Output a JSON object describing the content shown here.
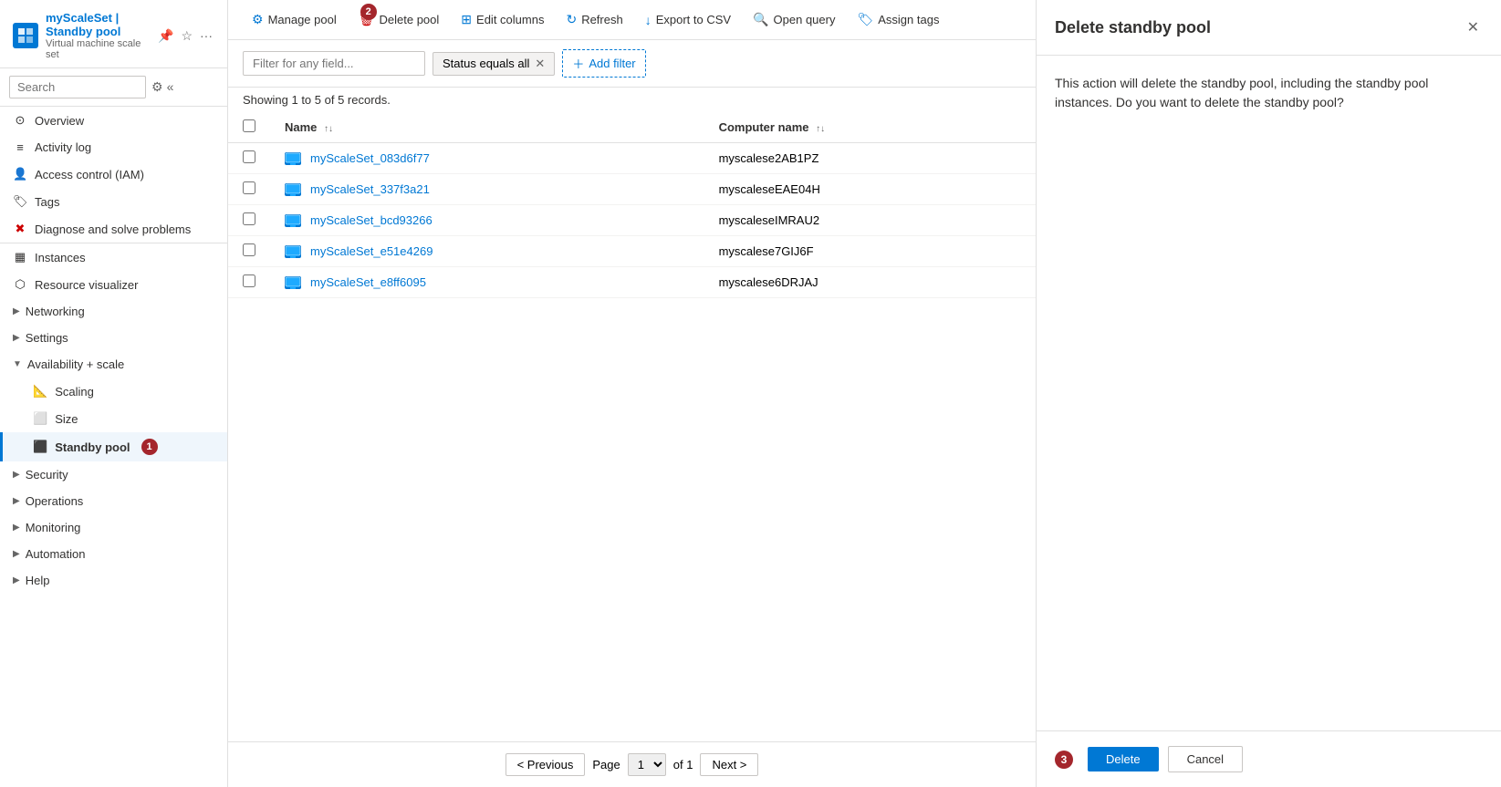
{
  "sidebar": {
    "brand": {
      "name": "myScaleSet",
      "separator": " | ",
      "section": "Standby pool",
      "subtitle": "Virtual machine scale set"
    },
    "search_placeholder": "Search",
    "nav_items": [
      {
        "id": "overview",
        "label": "Overview",
        "icon": "⊙",
        "active": false
      },
      {
        "id": "activity-log",
        "label": "Activity log",
        "icon": "≡",
        "active": false
      },
      {
        "id": "iam",
        "label": "Access control (IAM)",
        "icon": "👤",
        "active": false
      },
      {
        "id": "tags",
        "label": "Tags",
        "icon": "🏷",
        "active": false
      },
      {
        "id": "diagnose",
        "label": "Diagnose and solve problems",
        "icon": "✖",
        "active": false
      },
      {
        "id": "instances",
        "label": "Instances",
        "icon": "▦",
        "active": false
      },
      {
        "id": "resource-visualizer",
        "label": "Resource visualizer",
        "icon": "⬡",
        "active": false
      },
      {
        "id": "networking",
        "label": "Networking",
        "icon": "▶",
        "active": false,
        "expandable": true
      },
      {
        "id": "settings",
        "label": "Settings",
        "icon": "▶",
        "active": false,
        "expandable": true
      }
    ],
    "availability_scale": {
      "label": "Availability + scale",
      "expanded": true,
      "items": [
        {
          "id": "scaling",
          "label": "Scaling",
          "icon": "📐",
          "active": false
        },
        {
          "id": "size",
          "label": "Size",
          "icon": "⬜",
          "active": false
        },
        {
          "id": "standby-pool",
          "label": "Standby pool",
          "icon": "⬛",
          "active": true,
          "badge": "1"
        }
      ]
    },
    "security": {
      "label": "Security",
      "expandable": true,
      "expanded": false
    },
    "operations": {
      "label": "Operations",
      "expandable": true,
      "expanded": false
    },
    "monitoring": {
      "label": "Monitoring",
      "expandable": true,
      "expanded": false
    },
    "automation": {
      "label": "Automation",
      "expandable": true,
      "expanded": false
    },
    "help": {
      "label": "Help",
      "expandable": true,
      "expanded": false
    }
  },
  "toolbar": {
    "manage_pool": "Manage pool",
    "delete_pool": "Delete pool",
    "edit_columns": "Edit columns",
    "refresh": "Refresh",
    "export_csv": "Export to CSV",
    "open_query": "Open query",
    "assign_tags": "Assign tags",
    "refresh_badge": "2"
  },
  "filter": {
    "placeholder": "Filter for any field...",
    "chip_label": "Status equals all",
    "add_filter": "Add filter"
  },
  "table": {
    "showing_text": "Showing 1 to 5 of 5 records.",
    "columns": [
      {
        "id": "name",
        "label": "Name",
        "sortable": true
      },
      {
        "id": "computer_name",
        "label": "Computer name",
        "sortable": true
      }
    ],
    "rows": [
      {
        "id": "1",
        "name": "myScaleSet_083d6f77",
        "computer_name": "myscalese2AB1PZ"
      },
      {
        "id": "2",
        "name": "myScaleSet_337f3a21",
        "computer_name": "myscaleseEAE04H"
      },
      {
        "id": "3",
        "name": "myScaleSet_bcd93266",
        "computer_name": "myscaleseIMRAU2"
      },
      {
        "id": "4",
        "name": "myScaleSet_e51e4269",
        "computer_name": "myscalese7GIJ6F"
      },
      {
        "id": "5",
        "name": "myScaleSet_e8ff6095",
        "computer_name": "myscalese6DRJAJ"
      }
    ]
  },
  "pagination": {
    "previous_label": "< Previous",
    "next_label": "Next >",
    "page_label": "Page",
    "of_label": "of 1",
    "page_value": "1"
  },
  "panel": {
    "title": "Delete standby pool",
    "description": "This action will delete the standby pool, including the standby pool instances. Do you want to delete the standby pool?",
    "delete_label": "Delete",
    "cancel_label": "Cancel",
    "badge": "3"
  }
}
